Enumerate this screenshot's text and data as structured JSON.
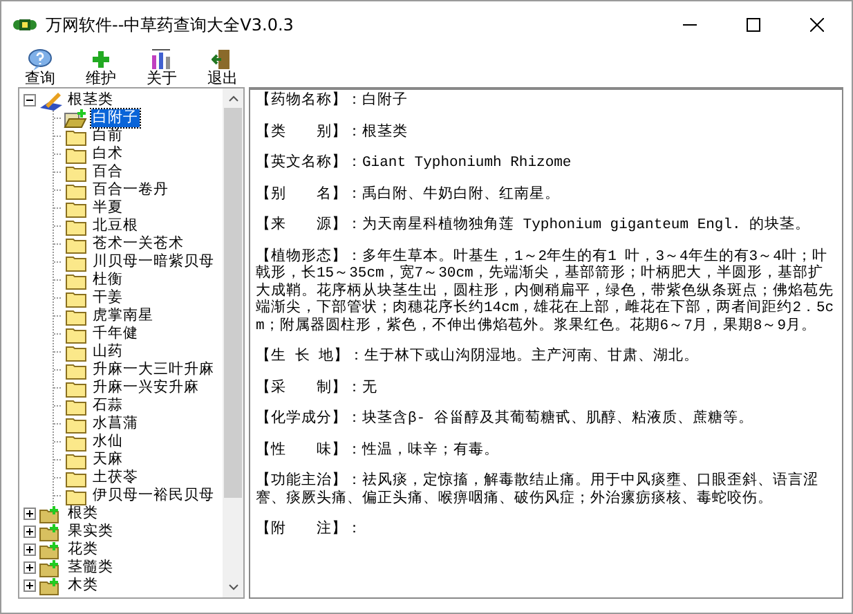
{
  "window": {
    "title": "万网软件--中草药查询大全V3.0.3"
  },
  "toolbar": [
    {
      "kind": "query",
      "label": "查询"
    },
    {
      "kind": "maintain",
      "label": "维护"
    },
    {
      "kind": "about",
      "label": "关于"
    },
    {
      "kind": "exit",
      "label": "退出"
    }
  ],
  "tree": [
    {
      "label": "根茎类",
      "expanded": true,
      "children": [
        {
          "label": "白附子",
          "selected": true
        },
        {
          "label": "白前",
          "selected": false
        },
        {
          "label": "白术",
          "selected": false
        },
        {
          "label": "百合",
          "selected": false
        },
        {
          "label": "百合一卷丹",
          "selected": false
        },
        {
          "label": "半夏",
          "selected": false
        },
        {
          "label": "北豆根",
          "selected": false
        },
        {
          "label": "苍术一关苍术",
          "selected": false
        },
        {
          "label": "川贝母一暗紫贝母",
          "selected": false
        },
        {
          "label": "杜衡",
          "selected": false
        },
        {
          "label": "干姜",
          "selected": false
        },
        {
          "label": "虎掌南星",
          "selected": false
        },
        {
          "label": "千年健",
          "selected": false
        },
        {
          "label": "山药",
          "selected": false
        },
        {
          "label": "升麻一大三叶升麻",
          "selected": false
        },
        {
          "label": "升麻一兴安升麻",
          "selected": false
        },
        {
          "label": "石蒜",
          "selected": false
        },
        {
          "label": "水菖蒲",
          "selected": false
        },
        {
          "label": "水仙",
          "selected": false
        },
        {
          "label": "天麻",
          "selected": false
        },
        {
          "label": "土茯苓",
          "selected": false
        },
        {
          "label": "伊贝母一裕民贝母",
          "selected": false
        }
      ]
    },
    {
      "label": "根类",
      "expanded": false
    },
    {
      "label": "果实类",
      "expanded": false
    },
    {
      "label": "花类",
      "expanded": false
    },
    {
      "label": "茎髓类",
      "expanded": false
    },
    {
      "label": "木类",
      "expanded": false
    }
  ],
  "detail": [
    {
      "label": "【药物名称】：",
      "value": "白附子"
    },
    {
      "label": "【类　　别】：",
      "value": "根茎类"
    },
    {
      "label": "【英文名称】：",
      "value": "Giant Typhoniumh Rhizome"
    },
    {
      "label": "【别　　名】：",
      "value": "禹白附、牛奶白附、红南星。"
    },
    {
      "label": "【来　　源】：",
      "value": "为天南星科植物独角莲 Typhonium giganteum Engl. 的块茎。"
    },
    {
      "label": "【植物形态】：",
      "value": "多年生草本。叶基生，1～2年生的有1 叶，3～4年生的有3～4叶；叶戟形，长15～35cm，宽7～30cm，先端渐尖，基部箭形；叶柄肥大，半圆形，基部扩大成鞘。花序柄从块茎生出，圆柱形，内侧稍扁平，绿色，带紫色纵条斑点；佛焰苞先端渐尖，下部管状；肉穗花序长约14cm，雄花在上部，雌花在下部，两者间距约2．5cm；附属器圆柱形，紫色，不伸出佛焰苞外。浆果红色。花期6～7月，果期8～9月。"
    },
    {
      "label": "【生 长 地】：",
      "value": "生于林下或山沟阴湿地。主产河南、甘肃、湖北。"
    },
    {
      "label": "【采　　制】：",
      "value": "无"
    },
    {
      "label": "【化学成分】：",
      "value": "块茎含β- 谷甾醇及其葡萄糖甙、肌醇、粘液质、蔗糖等。"
    },
    {
      "label": "【性　　味】：",
      "value": "性温，味辛；有毒。"
    },
    {
      "label": "【功能主治】：",
      "value": "祛风痰，定惊搐，解毒散结止痛。用于中风痰壅、口眼歪斜、语言涩謇、痰厥头痛、偏正头痛、喉痹咽痛、破伤风症；外治瘰疬痰核、毒蛇咬伤。"
    },
    {
      "label": "【附　　注】："
    }
  ]
}
